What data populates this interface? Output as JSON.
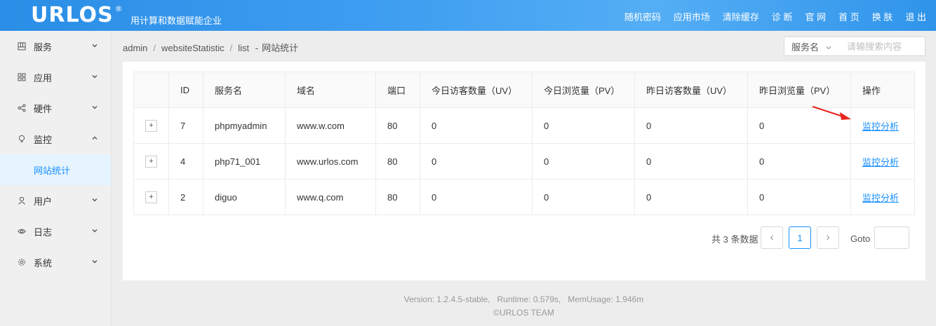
{
  "header": {
    "logo": "URLOS",
    "logo_mark": "®",
    "slogan": "用计算和数据赋能企业",
    "nav": [
      "随机密码",
      "应用市场",
      "清除缓存",
      "诊 断",
      "官 网",
      "首 页",
      "换 肤",
      "退 出"
    ]
  },
  "sidebar": {
    "items": [
      {
        "label": "服务",
        "icon": "grid-icon"
      },
      {
        "label": "应用",
        "icon": "apps-icon"
      },
      {
        "label": "硬件",
        "icon": "share-icon"
      },
      {
        "label": "监控",
        "icon": "bulb-icon"
      },
      {
        "label": "用户",
        "icon": "user-icon"
      },
      {
        "label": "日志",
        "icon": "eye-icon"
      },
      {
        "label": "系统",
        "icon": "gear-icon"
      }
    ],
    "sub_item": "网站统计"
  },
  "breadcrumb": {
    "parts": [
      "admin",
      "websiteStatistic",
      "list"
    ],
    "current": "网站统计",
    "sep": "/",
    "dash": "-"
  },
  "search": {
    "select_value": "服务名",
    "placeholder": "请输搜索内容"
  },
  "table": {
    "headers": [
      "ID",
      "服务名",
      "域名",
      "端口",
      "今日访客数量（UV）",
      "今日浏览量（PV）",
      "昨日访客数量（UV）",
      "昨日浏览量（PV）",
      "操作"
    ],
    "rows": [
      {
        "id": "7",
        "name": "phpmyadmin",
        "domain": "www.w.com",
        "port": "80",
        "uv_today": "0",
        "pv_today": "0",
        "uv_yest": "0",
        "pv_yest": "0",
        "action": "监控分析"
      },
      {
        "id": "4",
        "name": "php71_001",
        "domain": "www.urlos.com",
        "port": "80",
        "uv_today": "0",
        "pv_today": "0",
        "uv_yest": "0",
        "pv_yest": "0",
        "action": "监控分析"
      },
      {
        "id": "2",
        "name": "diguo",
        "domain": "www.q.com",
        "port": "80",
        "uv_today": "0",
        "pv_today": "0",
        "uv_yest": "0",
        "pv_yest": "0",
        "action": "监控分析"
      }
    ],
    "expand_symbol": "+"
  },
  "pagination": {
    "total_text": "共 3 条数据",
    "current_page": "1",
    "goto_label": "Goto",
    "prev": "‹",
    "next": "›"
  },
  "footer": {
    "version": "Version: 1.2.4.5-stable,",
    "runtime": "Runtime: 0.579s,",
    "mem": "MemUsage: 1.946m",
    "copyright": "©URLOS TEAM"
  },
  "colors": {
    "accent": "#1890ff",
    "header": "#3d9df0",
    "annotation": "#e8251f"
  }
}
